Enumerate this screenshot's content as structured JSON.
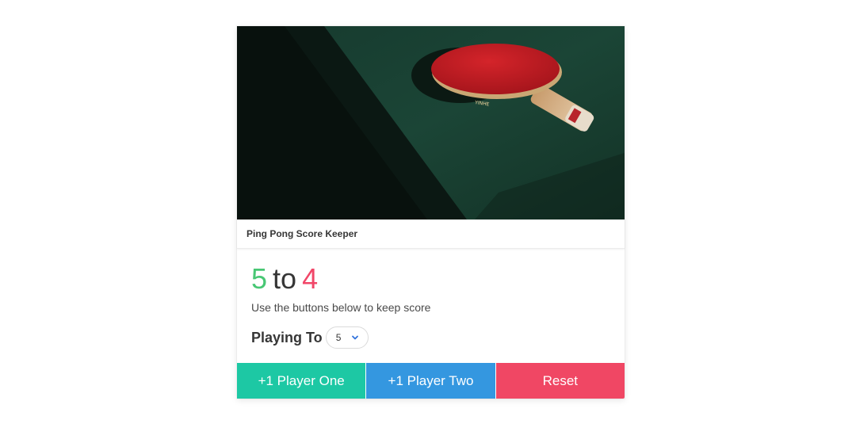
{
  "card": {
    "image_alt": "ping pong paddle on table",
    "header_title": "Ping Pong Score Keeper"
  },
  "score": {
    "player_one": "5",
    "separator": "to",
    "player_two": "4"
  },
  "subtitle": "Use the buttons below to keep score",
  "playing_to": {
    "label": "Playing To",
    "selected": "5"
  },
  "buttons": {
    "player_one": "+1 Player One",
    "player_two": "+1 Player Two",
    "reset": "Reset"
  },
  "colors": {
    "player_one": "#48c774",
    "player_two": "#f14668",
    "primary": "#1dc8a4",
    "info": "#3497e0",
    "danger": "#f04764"
  },
  "icons": {
    "select_chevron": "chevron-down-icon"
  }
}
